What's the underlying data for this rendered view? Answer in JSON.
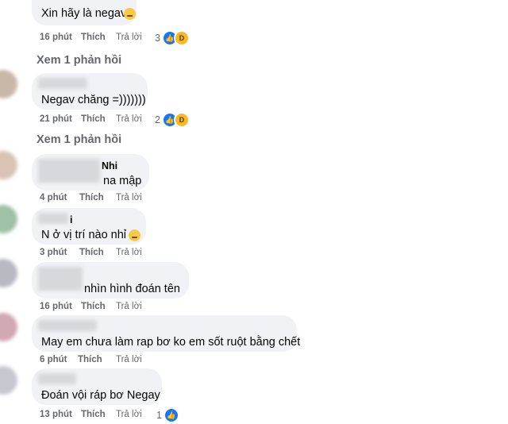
{
  "labels": {
    "like": "Thích",
    "reply": "Trả lời"
  },
  "comments": [
    {
      "text": "Xin hãy là negav",
      "emoji": "weary-face-icon",
      "time": "16 phút",
      "reactions": "3",
      "reaction_icons": [
        "like-icon",
        "haha-icon"
      ],
      "view_replies": "Xem 1 phản hồi"
    },
    {
      "text": "Negav chăng =)))))))",
      "time": "21 phút",
      "reactions": "2",
      "reaction_icons": [
        "like-icon",
        "haha-icon"
      ],
      "view_replies": "Xem 1 phản hồi"
    },
    {
      "name_tail": "Nhi",
      "text": "na mập",
      "time": "4 phút"
    },
    {
      "name_tail": "i",
      "text": "N ở vị trí nào nhỉ",
      "emoji": "thinking-face-icon",
      "time": "3 phút"
    },
    {
      "text": "nhìn hình đoán tên",
      "time": "16 phút"
    },
    {
      "text": "May em chưa làm rap bơ ko em sốt ruột bằng chết",
      "time": "6 phút"
    },
    {
      "text": "Đoán vội ráp bơ Negay",
      "time": "13 phút",
      "reactions": "1",
      "reaction_icons": [
        "like-icon"
      ]
    }
  ],
  "colors": {
    "bubble": "#f0f2f5",
    "meta": "#65676b",
    "like_blue": "#1877f2",
    "haha_yellow": "#f7b928"
  }
}
